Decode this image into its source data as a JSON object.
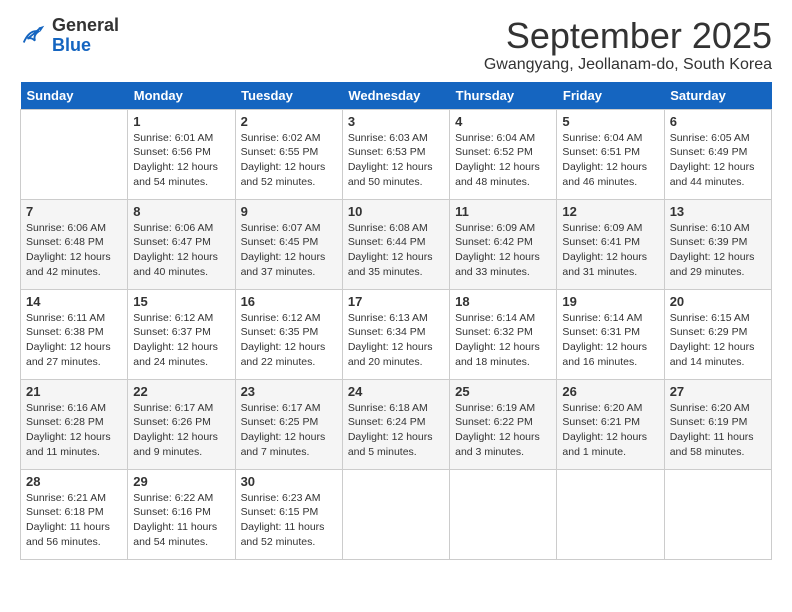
{
  "header": {
    "logo_general": "General",
    "logo_blue": "Blue",
    "month_title": "September 2025",
    "location": "Gwangyang, Jeollanam-do, South Korea"
  },
  "days_of_week": [
    "Sunday",
    "Monday",
    "Tuesday",
    "Wednesday",
    "Thursday",
    "Friday",
    "Saturday"
  ],
  "weeks": [
    [
      {
        "day": "",
        "info": ""
      },
      {
        "day": "1",
        "info": "Sunrise: 6:01 AM\nSunset: 6:56 PM\nDaylight: 12 hours and 54 minutes."
      },
      {
        "day": "2",
        "info": "Sunrise: 6:02 AM\nSunset: 6:55 PM\nDaylight: 12 hours and 52 minutes."
      },
      {
        "day": "3",
        "info": "Sunrise: 6:03 AM\nSunset: 6:53 PM\nDaylight: 12 hours and 50 minutes."
      },
      {
        "day": "4",
        "info": "Sunrise: 6:04 AM\nSunset: 6:52 PM\nDaylight: 12 hours and 48 minutes."
      },
      {
        "day": "5",
        "info": "Sunrise: 6:04 AM\nSunset: 6:51 PM\nDaylight: 12 hours and 46 minutes."
      },
      {
        "day": "6",
        "info": "Sunrise: 6:05 AM\nSunset: 6:49 PM\nDaylight: 12 hours and 44 minutes."
      }
    ],
    [
      {
        "day": "7",
        "info": "Sunrise: 6:06 AM\nSunset: 6:48 PM\nDaylight: 12 hours and 42 minutes."
      },
      {
        "day": "8",
        "info": "Sunrise: 6:06 AM\nSunset: 6:47 PM\nDaylight: 12 hours and 40 minutes."
      },
      {
        "day": "9",
        "info": "Sunrise: 6:07 AM\nSunset: 6:45 PM\nDaylight: 12 hours and 37 minutes."
      },
      {
        "day": "10",
        "info": "Sunrise: 6:08 AM\nSunset: 6:44 PM\nDaylight: 12 hours and 35 minutes."
      },
      {
        "day": "11",
        "info": "Sunrise: 6:09 AM\nSunset: 6:42 PM\nDaylight: 12 hours and 33 minutes."
      },
      {
        "day": "12",
        "info": "Sunrise: 6:09 AM\nSunset: 6:41 PM\nDaylight: 12 hours and 31 minutes."
      },
      {
        "day": "13",
        "info": "Sunrise: 6:10 AM\nSunset: 6:39 PM\nDaylight: 12 hours and 29 minutes."
      }
    ],
    [
      {
        "day": "14",
        "info": "Sunrise: 6:11 AM\nSunset: 6:38 PM\nDaylight: 12 hours and 27 minutes."
      },
      {
        "day": "15",
        "info": "Sunrise: 6:12 AM\nSunset: 6:37 PM\nDaylight: 12 hours and 24 minutes."
      },
      {
        "day": "16",
        "info": "Sunrise: 6:12 AM\nSunset: 6:35 PM\nDaylight: 12 hours and 22 minutes."
      },
      {
        "day": "17",
        "info": "Sunrise: 6:13 AM\nSunset: 6:34 PM\nDaylight: 12 hours and 20 minutes."
      },
      {
        "day": "18",
        "info": "Sunrise: 6:14 AM\nSunset: 6:32 PM\nDaylight: 12 hours and 18 minutes."
      },
      {
        "day": "19",
        "info": "Sunrise: 6:14 AM\nSunset: 6:31 PM\nDaylight: 12 hours and 16 minutes."
      },
      {
        "day": "20",
        "info": "Sunrise: 6:15 AM\nSunset: 6:29 PM\nDaylight: 12 hours and 14 minutes."
      }
    ],
    [
      {
        "day": "21",
        "info": "Sunrise: 6:16 AM\nSunset: 6:28 PM\nDaylight: 12 hours and 11 minutes."
      },
      {
        "day": "22",
        "info": "Sunrise: 6:17 AM\nSunset: 6:26 PM\nDaylight: 12 hours and 9 minutes."
      },
      {
        "day": "23",
        "info": "Sunrise: 6:17 AM\nSunset: 6:25 PM\nDaylight: 12 hours and 7 minutes."
      },
      {
        "day": "24",
        "info": "Sunrise: 6:18 AM\nSunset: 6:24 PM\nDaylight: 12 hours and 5 minutes."
      },
      {
        "day": "25",
        "info": "Sunrise: 6:19 AM\nSunset: 6:22 PM\nDaylight: 12 hours and 3 minutes."
      },
      {
        "day": "26",
        "info": "Sunrise: 6:20 AM\nSunset: 6:21 PM\nDaylight: 12 hours and 1 minute."
      },
      {
        "day": "27",
        "info": "Sunrise: 6:20 AM\nSunset: 6:19 PM\nDaylight: 11 hours and 58 minutes."
      }
    ],
    [
      {
        "day": "28",
        "info": "Sunrise: 6:21 AM\nSunset: 6:18 PM\nDaylight: 11 hours and 56 minutes."
      },
      {
        "day": "29",
        "info": "Sunrise: 6:22 AM\nSunset: 6:16 PM\nDaylight: 11 hours and 54 minutes."
      },
      {
        "day": "30",
        "info": "Sunrise: 6:23 AM\nSunset: 6:15 PM\nDaylight: 11 hours and 52 minutes."
      },
      {
        "day": "",
        "info": ""
      },
      {
        "day": "",
        "info": ""
      },
      {
        "day": "",
        "info": ""
      },
      {
        "day": "",
        "info": ""
      }
    ]
  ]
}
